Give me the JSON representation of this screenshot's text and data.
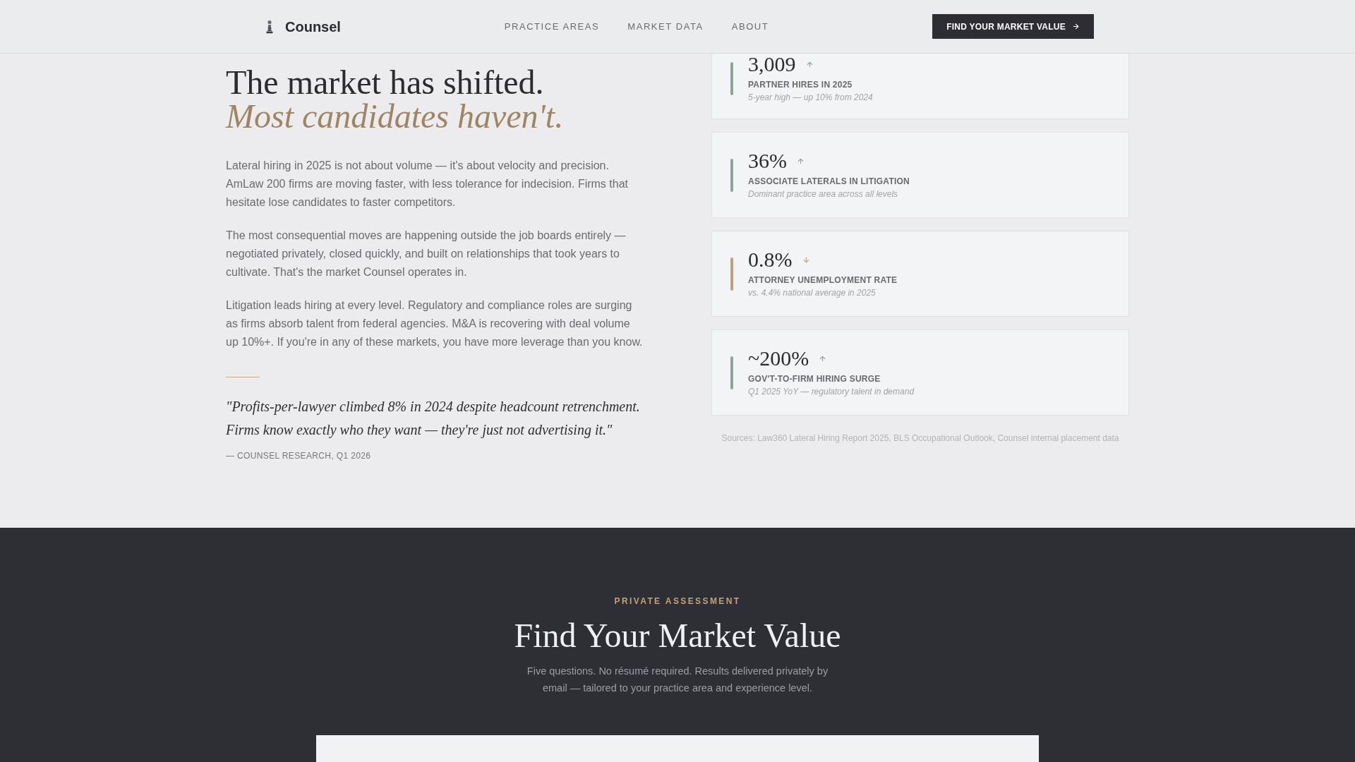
{
  "header": {
    "brand": "Counsel",
    "nav": [
      {
        "label": "PRACTICE AREAS"
      },
      {
        "label": "MARKET DATA"
      },
      {
        "label": "ABOUT"
      }
    ],
    "cta": {
      "label": "FIND YOUR MARKET VALUE"
    }
  },
  "intro": {
    "headline": "The market has shifted.",
    "headline_accent": "Most candidates haven't.",
    "paragraphs": [
      "Lateral hiring in 2025 is not about volume — it's about velocity and precision. AmLaw 200 firms are moving faster, with less tolerance for indecision. Firms that hesitate lose candidates to faster competitors.",
      "The most consequential moves are happening outside the job boards entirely — negotiated privately, closed quickly, and built on relationships that took years to cultivate. That's the market Counsel operates in.",
      "Litigation leads hiring at every level. Regulatory and compliance roles are surging as firms absorb talent from federal agencies. M&A is recovering with deal volume up 10%+. If you're in any of these markets, you have more leverage than you know."
    ],
    "quote": "\"Profits-per-lawyer climbed 8% in 2024 despite headcount retrenchment. Firms know exactly who they want — they're just not advertising it.\"",
    "attribution": "— COUNSEL RESEARCH, Q1 2026"
  },
  "stats": [
    {
      "value": "3,009",
      "rising": true,
      "label": "PARTNER HIRES IN 2025",
      "note": "5-year high — up 10% from 2024",
      "color": "#8aa898"
    },
    {
      "value": "36%",
      "rising": true,
      "label": "ASSOCIATE LATERALS IN LITIGATION",
      "note": "Dominant practice area across all levels",
      "color": "#8aa898"
    },
    {
      "value": "0.8%",
      "rising": false,
      "label": "ATTORNEY UNEMPLOYMENT RATE",
      "note": "vs. 4.4% national average in 2025",
      "color": "#c4a07a"
    },
    {
      "value": "~200%",
      "rising": true,
      "label": "GOV'T-TO-FIRM HIRING SURGE",
      "note": "Q1 2025 YoY — regulatory talent in demand",
      "color": "#8aa898"
    }
  ],
  "sources": "Sources: Law360 Lateral Hiring Report 2025, BLS Occupational Outlook, Counsel internal placement data",
  "assessment": {
    "eyebrow": "PRIVATE ASSESSMENT",
    "title": "Find Your Market Value",
    "description": "Five questions. No résumé required. Results delivered privately by email — tailored to your practice area and experience level."
  }
}
